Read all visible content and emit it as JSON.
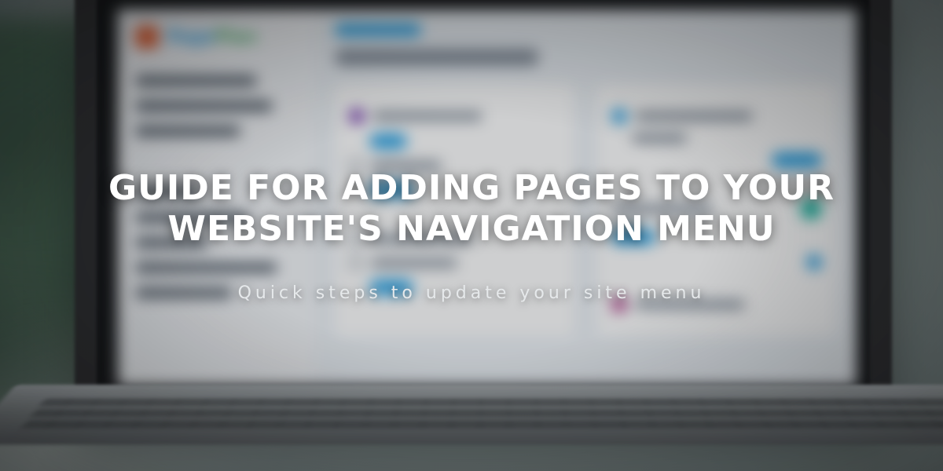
{
  "headline": "GUIDE FOR ADDING PAGES TO YOUR WEBSITE'S NAVIGATION MENU",
  "subhead": "Quick steps to update your site menu"
}
